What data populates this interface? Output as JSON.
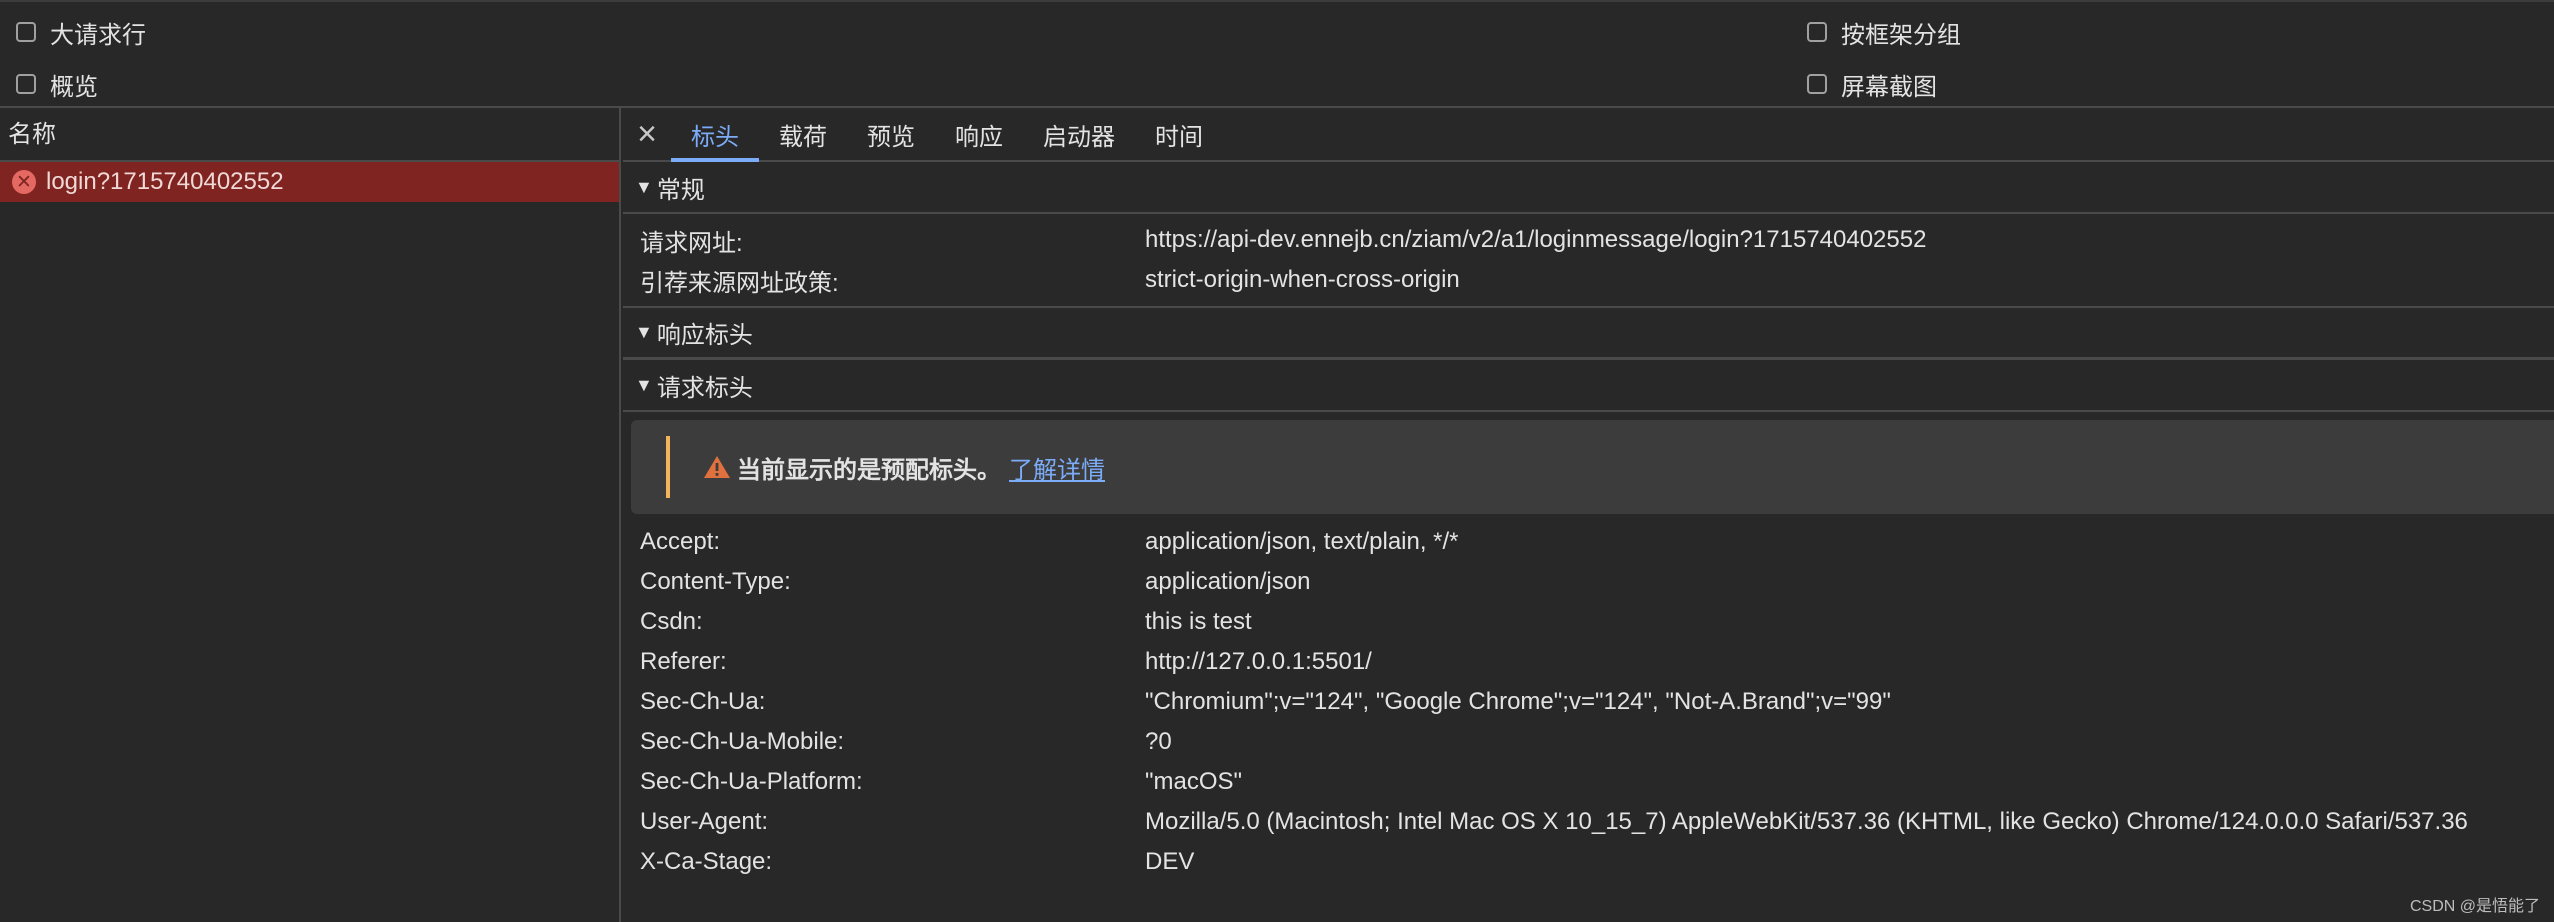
{
  "options": {
    "large_rows": "大请求行",
    "overview": "概览",
    "group_by_frame": "按框架分组",
    "screenshots": "屏幕截图"
  },
  "request_list": {
    "header": "名称",
    "items": [
      {
        "name": "login?1715740402552",
        "status": "error"
      }
    ]
  },
  "tabs": [
    "标头",
    "载荷",
    "预览",
    "响应",
    "启动器",
    "时间"
  ],
  "active_tab": "标头",
  "general": {
    "title": "常规",
    "rows": [
      {
        "key": "请求网址:",
        "value": "https://api-dev.ennejb.cn/ziam/v2/a1/loginmessage/login?1715740402552"
      },
      {
        "key": "引荐来源网址政策:",
        "value": "strict-origin-when-cross-origin"
      }
    ]
  },
  "response_headers": {
    "title": "响应标头"
  },
  "request_headers": {
    "title": "请求标头",
    "warning": "当前显示的是预配标头。",
    "warning_link": "了解详情",
    "rows": [
      {
        "key": "Accept:",
        "value": "application/json, text/plain, */*"
      },
      {
        "key": "Content-Type:",
        "value": "application/json"
      },
      {
        "key": "Csdn:",
        "value": "this is test"
      },
      {
        "key": "Referer:",
        "value": "http://127.0.0.1:5501/"
      },
      {
        "key": "Sec-Ch-Ua:",
        "value": "\"Chromium\";v=\"124\", \"Google Chrome\";v=\"124\", \"Not-A.Brand\";v=\"99\""
      },
      {
        "key": "Sec-Ch-Ua-Mobile:",
        "value": "?0"
      },
      {
        "key": "Sec-Ch-Ua-Platform:",
        "value": "\"macOS\""
      },
      {
        "key": "User-Agent:",
        "value": "Mozilla/5.0 (Macintosh; Intel Mac OS X 10_15_7) AppleWebKit/537.36 (KHTML, like Gecko) Chrome/124.0.0.0 Safari/537.36"
      },
      {
        "key": "X-Ca-Stage:",
        "value": "DEV"
      }
    ]
  },
  "watermark": "CSDN @是悟能了",
  "colors": {
    "background": "#282828",
    "accent": "#7cacf8",
    "error_row": "#7f2420",
    "warning": "#f2b35b"
  },
  "icons": {
    "close": "close-icon",
    "error": "error-circle-icon",
    "warning": "warning-triangle-icon",
    "expand": "triangle-down-icon"
  }
}
